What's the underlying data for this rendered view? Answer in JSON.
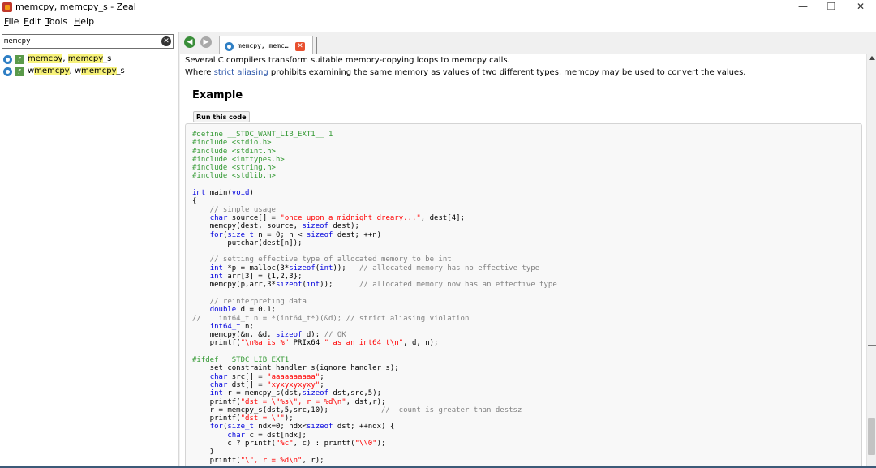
{
  "window": {
    "title": "memcpy, memcpy_s - Zeal",
    "minimize": "—",
    "maximize": "❐",
    "close": "✕"
  },
  "menu": {
    "file_u": "F",
    "file_rest": "ile",
    "edit_u": "E",
    "edit_rest": "dit",
    "tools_u": "T",
    "tools_rest": "ools",
    "help_u": "H",
    "help_rest": "elp"
  },
  "search": {
    "value": "memcpy",
    "clear_glyph": "✕"
  },
  "results": [
    {
      "type_glyph": "f",
      "pre": "",
      "hl1": "memcpy",
      "mid": ", ",
      "hl2": "memcpy",
      "post": "_s"
    },
    {
      "type_glyph": "f",
      "pre": "w",
      "hl1": "memcpy",
      "mid": ", w",
      "hl2": "memcpy",
      "post": "_s"
    }
  ],
  "nav": {
    "back_glyph": "◀",
    "forward_glyph": "▶"
  },
  "tab": {
    "label": "memcpy, memc…",
    "close_glyph": "✕"
  },
  "content": {
    "para1": "Several C compilers transform suitable memory-copying loops to memcpy calls.",
    "para2_pre": "Where ",
    "para2_link": "strict aliasing",
    "para2_post": " prohibits examining the same memory as values of two different types, memcpy may be used to convert the values.",
    "heading": "Example",
    "run_button": "Run this code"
  },
  "code": [
    [
      [
        "pp",
        "#define __STDC_WANT_LIB_EXT1__ 1"
      ]
    ],
    [
      [
        "pp",
        "#include <stdio.h>"
      ]
    ],
    [
      [
        "pp",
        "#include <stdint.h>"
      ]
    ],
    [
      [
        "pp",
        "#include <inttypes.h>"
      ]
    ],
    [
      [
        "pp",
        "#include <string.h>"
      ]
    ],
    [
      [
        "pp",
        "#include <stdlib.h>"
      ]
    ],
    [
      [
        "plain",
        ""
      ]
    ],
    [
      [
        "kw",
        "int"
      ],
      [
        "plain",
        " main("
      ],
      [
        "kw",
        "void"
      ],
      [
        "plain",
        ")"
      ]
    ],
    [
      [
        "plain",
        "{"
      ]
    ],
    [
      [
        "cm",
        "    // simple usage"
      ]
    ],
    [
      [
        "plain",
        "    "
      ],
      [
        "kw",
        "char"
      ],
      [
        "plain",
        " source[] = "
      ],
      [
        "str",
        "\"once upon a midnight dreary...\""
      ],
      [
        "plain",
        ", dest[4];"
      ]
    ],
    [
      [
        "plain",
        "    memcpy(dest, source, "
      ],
      [
        "kw",
        "sizeof"
      ],
      [
        "plain",
        " dest);"
      ]
    ],
    [
      [
        "plain",
        "    "
      ],
      [
        "kw",
        "for"
      ],
      [
        "plain",
        "("
      ],
      [
        "kw",
        "size_t"
      ],
      [
        "plain",
        " n = 0; n < "
      ],
      [
        "kw",
        "sizeof"
      ],
      [
        "plain",
        " dest; ++n)"
      ]
    ],
    [
      [
        "plain",
        "        putchar(dest[n]);"
      ]
    ],
    [
      [
        "plain",
        ""
      ]
    ],
    [
      [
        "cm",
        "    // setting effective type of allocated memory to be int"
      ]
    ],
    [
      [
        "plain",
        "    "
      ],
      [
        "kw",
        "int"
      ],
      [
        "plain",
        " *p = malloc(3*"
      ],
      [
        "kw",
        "sizeof"
      ],
      [
        "plain",
        "("
      ],
      [
        "kw",
        "int"
      ],
      [
        "plain",
        "));   "
      ],
      [
        "cm",
        "// allocated memory has no effective type"
      ]
    ],
    [
      [
        "plain",
        "    "
      ],
      [
        "kw",
        "int"
      ],
      [
        "plain",
        " arr[3] = {1,2,3};"
      ]
    ],
    [
      [
        "plain",
        "    memcpy(p,arr,3*"
      ],
      [
        "kw",
        "sizeof"
      ],
      [
        "plain",
        "("
      ],
      [
        "kw",
        "int"
      ],
      [
        "plain",
        "));      "
      ],
      [
        "cm",
        "// allocated memory now has an effective type"
      ]
    ],
    [
      [
        "plain",
        ""
      ]
    ],
    [
      [
        "cm",
        "    // reinterpreting data"
      ]
    ],
    [
      [
        "plain",
        "    "
      ],
      [
        "kw",
        "double"
      ],
      [
        "plain",
        " d = 0.1;"
      ]
    ],
    [
      [
        "cm",
        "//    int64_t n = *(int64_t*)(&d); // strict aliasing violation"
      ]
    ],
    [
      [
        "plain",
        "    "
      ],
      [
        "kw",
        "int64_t"
      ],
      [
        "plain",
        " n;"
      ]
    ],
    [
      [
        "plain",
        "    memcpy(&n, &d, "
      ],
      [
        "kw",
        "sizeof"
      ],
      [
        "plain",
        " d); "
      ],
      [
        "cm",
        "// OK"
      ]
    ],
    [
      [
        "plain",
        "    printf("
      ],
      [
        "str",
        "\"\\n%a is %\""
      ],
      [
        "plain",
        " PRIx64 "
      ],
      [
        "str",
        "\" as an int64_t\\n\""
      ],
      [
        "plain",
        ", d, n);"
      ]
    ],
    [
      [
        "plain",
        ""
      ]
    ],
    [
      [
        "pp",
        "#ifdef __STDC_LIB_EXT1__"
      ]
    ],
    [
      [
        "plain",
        "    set_constraint_handler_s(ignore_handler_s);"
      ]
    ],
    [
      [
        "plain",
        "    "
      ],
      [
        "kw",
        "char"
      ],
      [
        "plain",
        " src[] = "
      ],
      [
        "str",
        "\"aaaaaaaaaa\""
      ],
      [
        "plain",
        ";"
      ]
    ],
    [
      [
        "plain",
        "    "
      ],
      [
        "kw",
        "char"
      ],
      [
        "plain",
        " dst[] = "
      ],
      [
        "str",
        "\"xyxyxyxyxy\""
      ],
      [
        "plain",
        ";"
      ]
    ],
    [
      [
        "plain",
        "    "
      ],
      [
        "kw",
        "int"
      ],
      [
        "plain",
        " r = memcpy_s(dst,"
      ],
      [
        "kw",
        "sizeof"
      ],
      [
        "plain",
        " dst,src,5);"
      ]
    ],
    [
      [
        "plain",
        "    printf("
      ],
      [
        "str",
        "\"dst = \\\"%s\\\", r = %d\\n\""
      ],
      [
        "plain",
        ", dst,r);"
      ]
    ],
    [
      [
        "plain",
        "    r = memcpy_s(dst,5,src,10);            "
      ],
      [
        "cm",
        "//  count is greater than destsz"
      ]
    ],
    [
      [
        "plain",
        "    printf("
      ],
      [
        "str",
        "\"dst = \\\"\""
      ],
      [
        "plain",
        ");"
      ]
    ],
    [
      [
        "plain",
        "    "
      ],
      [
        "kw",
        "for"
      ],
      [
        "plain",
        "("
      ],
      [
        "kw",
        "size_t"
      ],
      [
        "plain",
        " ndx=0; ndx<"
      ],
      [
        "kw",
        "sizeof"
      ],
      [
        "plain",
        " dst; ++ndx) {"
      ]
    ],
    [
      [
        "plain",
        "        "
      ],
      [
        "kw",
        "char"
      ],
      [
        "plain",
        " c = dst[ndx];"
      ]
    ],
    [
      [
        "plain",
        "        c ? printf("
      ],
      [
        "str",
        "\"%c\""
      ],
      [
        "plain",
        ", c) : printf("
      ],
      [
        "str",
        "\"\\\\0\""
      ],
      [
        "plain",
        ");"
      ]
    ],
    [
      [
        "plain",
        "    }"
      ]
    ],
    [
      [
        "plain",
        "    printf("
      ],
      [
        "str",
        "\"\\\", r = %d\\n\""
      ],
      [
        "plain",
        ", r);"
      ]
    ]
  ]
}
